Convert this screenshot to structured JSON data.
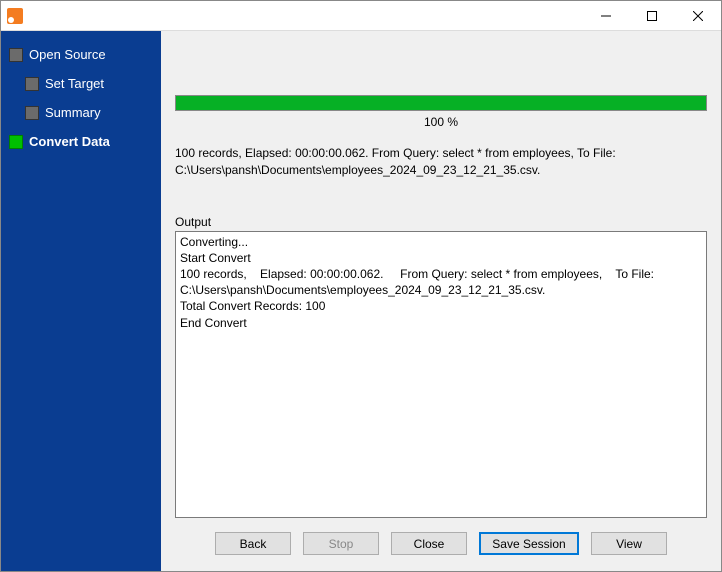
{
  "sidebar": {
    "items": [
      {
        "label": "Open Source"
      },
      {
        "label": "Set Target"
      },
      {
        "label": "Summary"
      },
      {
        "label": "Convert Data"
      }
    ]
  },
  "progress": {
    "percent_text": "100 %",
    "fill_width": "100%"
  },
  "summary_text": "100 records,    Elapsed: 00:00:00.062.     From Query: select * from employees,    To File: C:\\Users\\pansh\\Documents\\employees_2024_09_23_12_21_35.csv.",
  "output": {
    "label": "Output",
    "text": "Converting...\nStart Convert\n100 records,    Elapsed: 00:00:00.062.     From Query: select * from employees,    To File: C:\\Users\\pansh\\Documents\\employees_2024_09_23_12_21_35.csv.\nTotal Convert Records: 100\nEnd Convert"
  },
  "buttons": {
    "back": "Back",
    "stop": "Stop",
    "close": "Close",
    "save_session": "Save Session",
    "view": "View"
  }
}
